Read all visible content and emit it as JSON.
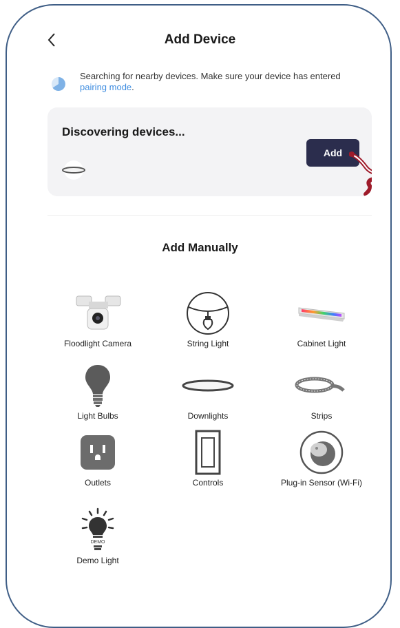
{
  "header": {
    "title": "Add Device"
  },
  "notice": {
    "text_before_link": "Searching for nearby devices. Make sure your device has entered ",
    "link_text": "pairing mode",
    "text_after_link": "."
  },
  "discovering_card": {
    "title": "Discovering devices...",
    "add_label": "Add"
  },
  "manual": {
    "title": "Add Manually",
    "items": [
      {
        "label": "Floodlight Camera",
        "icon": "floodlight-camera-icon"
      },
      {
        "label": "String Light",
        "icon": "string-light-icon"
      },
      {
        "label": "Cabinet Light",
        "icon": "cabinet-light-icon"
      },
      {
        "label": "Light Bulbs",
        "icon": "light-bulb-icon"
      },
      {
        "label": "Downlights",
        "icon": "downlight-icon"
      },
      {
        "label": "Strips",
        "icon": "strip-light-icon"
      },
      {
        "label": "Outlets",
        "icon": "outlet-icon"
      },
      {
        "label": "Controls",
        "icon": "switch-icon"
      },
      {
        "label": "Plug-in Sensor (Wi-Fi)",
        "icon": "plug-in-sensor-icon"
      },
      {
        "label": "Demo Light",
        "icon": "demo-light-icon",
        "badge": "DEMO"
      }
    ]
  },
  "colors": {
    "frame_border": "#3f5e86",
    "button_bg": "#2b2d4d",
    "link": "#3f8de0",
    "card_bg": "#f3f3f5",
    "hand_accent": "#9e1b2a"
  }
}
